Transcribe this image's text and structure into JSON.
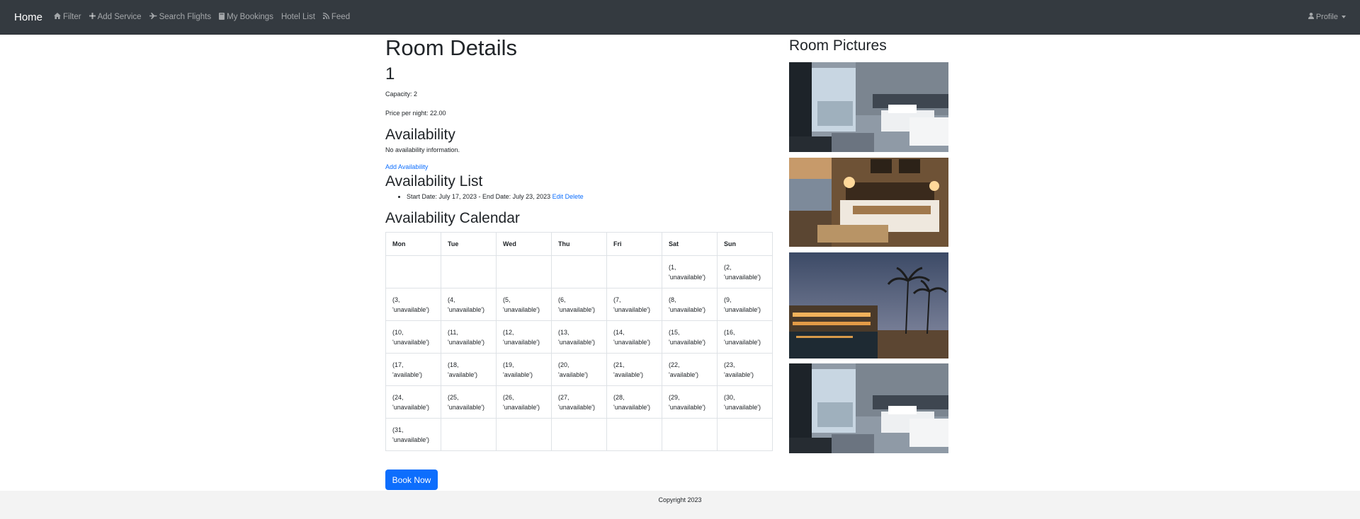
{
  "navbar": {
    "brand": "Home",
    "links": [
      {
        "label": "Filter",
        "icon": "home-icon"
      },
      {
        "label": "Add Service",
        "icon": "plus-icon"
      },
      {
        "label": "Search Flights",
        "icon": "plane-icon"
      },
      {
        "label": "My Bookings",
        "icon": "book-icon"
      },
      {
        "label": "Hotel List",
        "icon": ""
      },
      {
        "label": "Feed",
        "icon": "rss-icon"
      }
    ],
    "profile_label": "Profile",
    "profile_icon": "user-icon"
  },
  "room": {
    "title": "Room Details",
    "number": "1",
    "capacity": "Capacity: 2",
    "price": "Price per night: 22.00"
  },
  "availability": {
    "heading": "Availability",
    "no_info": "No availability information.",
    "add_link": "Add Availability"
  },
  "availability_list": {
    "heading": "Availability List",
    "items": [
      {
        "text": "Start Date: July 17, 2023 - End Date: July 23, 2023",
        "edit": "Edit",
        "delete": "Delete"
      }
    ]
  },
  "calendar": {
    "heading": "Availability Calendar",
    "days": [
      "Mon",
      "Tue",
      "Wed",
      "Thu",
      "Fri",
      "Sat",
      "Sun"
    ],
    "weeks": [
      [
        "",
        "",
        "",
        "",
        "",
        "(1, 'unavailable')",
        "(2, 'unavailable')"
      ],
      [
        "(3, 'unavailable')",
        "(4, 'unavailable')",
        "(5, 'unavailable')",
        "(6, 'unavailable')",
        "(7, 'unavailable')",
        "(8, 'unavailable')",
        "(9, 'unavailable')"
      ],
      [
        "(10, 'unavailable')",
        "(11, 'unavailable')",
        "(12, 'unavailable')",
        "(13, 'unavailable')",
        "(14, 'unavailable')",
        "(15, 'unavailable')",
        "(16, 'unavailable')"
      ],
      [
        "(17, 'available')",
        "(18, 'available')",
        "(19, 'available')",
        "(20, 'available')",
        "(21, 'available')",
        "(22, 'available')",
        "(23, 'available')"
      ],
      [
        "(24, 'unavailable')",
        "(25, 'unavailable')",
        "(26, 'unavailable')",
        "(27, 'unavailable')",
        "(28, 'unavailable')",
        "(29, 'unavailable')",
        "(30, 'unavailable')"
      ],
      [
        "(31, 'unavailable')",
        "",
        "",
        "",
        "",
        "",
        ""
      ]
    ]
  },
  "book_button": "Book Now",
  "pictures": {
    "heading": "Room Pictures",
    "images": [
      "hotel-room-twin-beds-photo",
      "hotel-room-king-bed-photo",
      "resort-pool-palms-photo",
      "hotel-room-twin-beds-photo"
    ]
  },
  "footer": {
    "text": "Copyright 2023"
  },
  "colors": {
    "navbar_bg": "#343a40",
    "link": "#0d6efd",
    "button_bg": "#0d6efd",
    "footer_bg": "#f3f3f3"
  }
}
